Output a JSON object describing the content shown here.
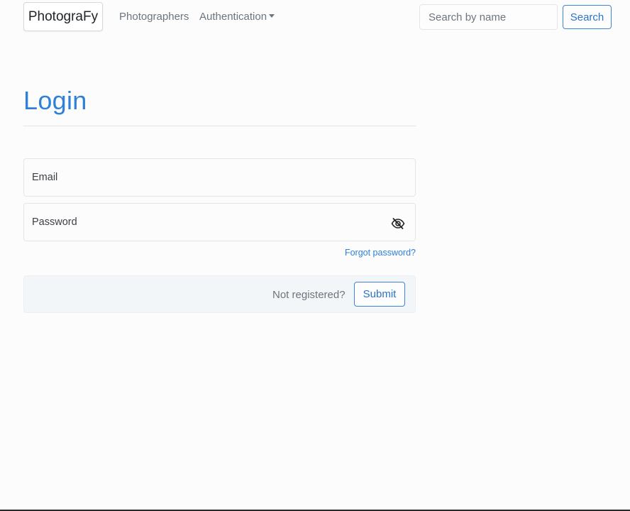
{
  "navbar": {
    "brand": "PhotograFy",
    "links": [
      {
        "label": "Photographers"
      },
      {
        "label": "Authentication"
      }
    ],
    "search": {
      "placeholder": "Search by name",
      "button_label": "Search"
    }
  },
  "login": {
    "title": "Login",
    "email_label": "Email",
    "password_label": "Password",
    "password_toggle_icon": "eye-slash-icon",
    "forgot_password": "Forgot password?",
    "not_registered": "Not registered?",
    "submit_label": "Submit"
  },
  "colors": {
    "accent": "#2f80d6",
    "muted": "#6c757d",
    "background": "#fcfcfd"
  }
}
